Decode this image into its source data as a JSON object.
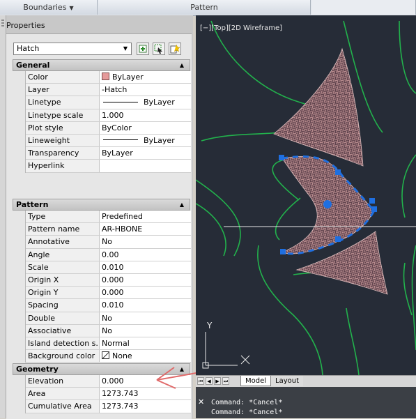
{
  "ribbon": {
    "boundaries_label": "Boundaries",
    "pattern_label": "Pattern"
  },
  "palette": {
    "title": "Properties",
    "selected_object": "Hatch",
    "sections": {
      "general": {
        "title": "General",
        "rows": [
          {
            "name": "Color",
            "value": "ByLayer"
          },
          {
            "name": "Layer",
            "value": "-Hatch"
          },
          {
            "name": "Linetype",
            "value": "ByLayer"
          },
          {
            "name": "Linetype scale",
            "value": "1.000"
          },
          {
            "name": "Plot style",
            "value": "ByColor"
          },
          {
            "name": "Lineweight",
            "value": "ByLayer"
          },
          {
            "name": "Transparency",
            "value": "ByLayer"
          },
          {
            "name": "Hyperlink",
            "value": ""
          }
        ]
      },
      "pattern": {
        "title": "Pattern",
        "rows": [
          {
            "name": "Type",
            "value": "Predefined"
          },
          {
            "name": "Pattern name",
            "value": "AR-HBONE"
          },
          {
            "name": "Annotative",
            "value": "No"
          },
          {
            "name": "Angle",
            "value": "0.00"
          },
          {
            "name": "Scale",
            "value": "0.010"
          },
          {
            "name": "Origin X",
            "value": "0.000"
          },
          {
            "name": "Origin Y",
            "value": "0.000"
          },
          {
            "name": "Spacing",
            "value": "0.010"
          },
          {
            "name": "Double",
            "value": "No"
          },
          {
            "name": "Associative",
            "value": "No"
          },
          {
            "name": "Island detection s...",
            "value": "Normal"
          },
          {
            "name": "Background color",
            "value": "None"
          }
        ]
      },
      "geometry": {
        "title": "Geometry",
        "rows": [
          {
            "name": "Elevation",
            "value": "0.000"
          },
          {
            "name": "Area",
            "value": "1273.743"
          },
          {
            "name": "Cumulative Area",
            "value": "1273.743"
          }
        ]
      }
    }
  },
  "viewport": {
    "label": "[−][Top][2D Wireframe]",
    "ucs_y": "Y"
  },
  "tabs": {
    "model": "Model",
    "layout": "Layout"
  },
  "command": {
    "line1": "Command: *Cancel*",
    "line2": "Command: *Cancel*"
  },
  "colors": {
    "viewport_bg": "#262c37",
    "boundary_green": "#22b24c",
    "hatch_pink": "#d9a6a6",
    "grip_blue": "#1f6fe0",
    "annotation_red": "#e06a6a"
  },
  "icons": [
    "quick-select-icon",
    "select-objects-icon",
    "toggle-pickadd-icon",
    "ucs-icon",
    "close-icon"
  ]
}
